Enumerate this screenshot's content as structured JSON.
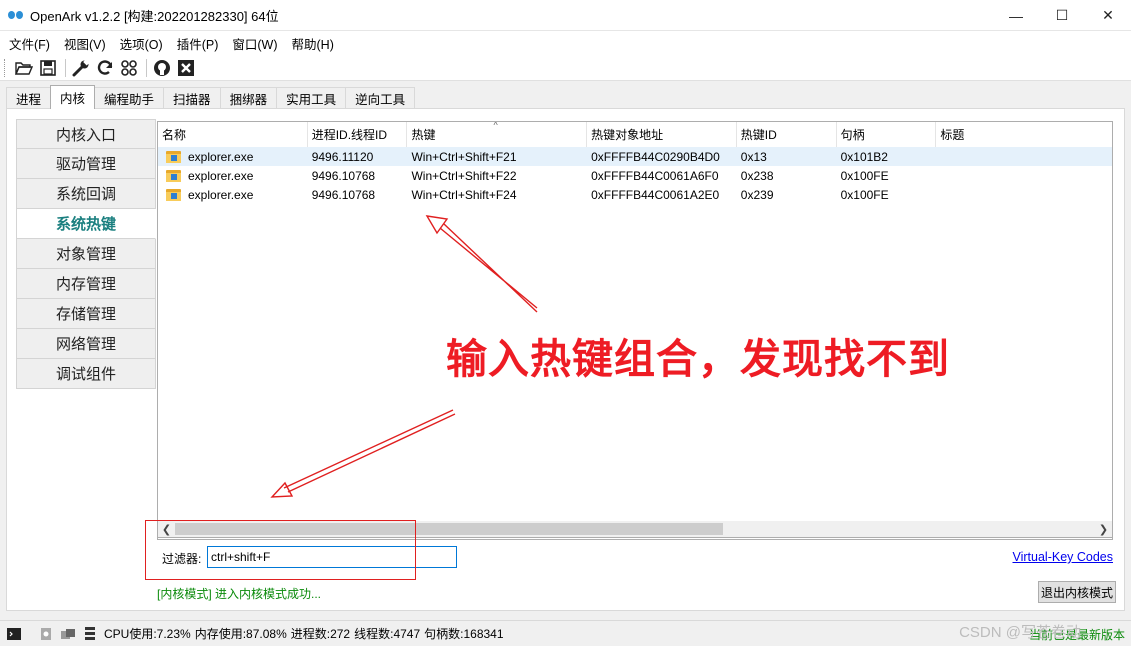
{
  "window": {
    "title": "OpenArk v1.2.2  [构建:202201282330]  64位",
    "minimize": "—",
    "maximize": "☐",
    "close": "✕"
  },
  "menu": [
    "文件(F)",
    "视图(V)",
    "选项(O)",
    "插件(P)",
    "窗口(W)",
    "帮助(H)"
  ],
  "toolbar_icons": [
    "open-folder-icon",
    "save-icon",
    "wrench-icon",
    "refresh-icon",
    "grid-icon",
    "github-icon",
    "close-box-icon"
  ],
  "tabs": [
    {
      "label": "进程",
      "active": false
    },
    {
      "label": "内核",
      "active": true
    },
    {
      "label": "编程助手",
      "active": false
    },
    {
      "label": "扫描器",
      "active": false
    },
    {
      "label": "捆绑器",
      "active": false
    },
    {
      "label": "实用工具",
      "active": false
    },
    {
      "label": "逆向工具",
      "active": false
    }
  ],
  "sidebar": [
    {
      "label": "内核入口",
      "active": false
    },
    {
      "label": "驱动管理",
      "active": false
    },
    {
      "label": "系统回调",
      "active": false
    },
    {
      "label": "系统热键",
      "active": true
    },
    {
      "label": "对象管理",
      "active": false
    },
    {
      "label": "内存管理",
      "active": false
    },
    {
      "label": "存储管理",
      "active": false
    },
    {
      "label": "网络管理",
      "active": false
    },
    {
      "label": "调试组件",
      "active": false
    }
  ],
  "table": {
    "columns": [
      "名称",
      "进程ID.线程ID",
      "热键",
      "热键对象地址",
      "热键ID",
      "句柄",
      "标题"
    ],
    "rows": [
      [
        "explorer.exe",
        "9496.11120",
        "Win+Ctrl+Shift+F21",
        "0xFFFFB44C0290B4D0",
        "0x13",
        "0x101B2",
        ""
      ],
      [
        "explorer.exe",
        "9496.10768",
        "Win+Ctrl+Shift+F22",
        "0xFFFFB44C0061A6F0",
        "0x238",
        "0x100FE",
        ""
      ],
      [
        "explorer.exe",
        "9496.10768",
        "Win+Ctrl+Shift+F24",
        "0xFFFFB44C0061A2E0",
        "0x239",
        "0x100FE",
        ""
      ]
    ]
  },
  "filter": {
    "label": "过滤器:",
    "value": "ctrl+shift+F"
  },
  "vk_link": "Virtual-Key Codes",
  "status_message": "[内核模式] 进入内核模式成功...",
  "exit_button": "退出内核模式",
  "statusbar": {
    "cpu": "CPU使用:7.23%",
    "mem": "内存使用:87.08%",
    "procs": "进程数:272",
    "threads": "线程数:4747",
    "handles": "句柄数:168341",
    "update": "当前已是最新版本",
    "watermark": "CSDN @写苍卷动"
  },
  "annotation": {
    "text": "输入热键组合，发现找不到",
    "color": "#ee1c24"
  }
}
